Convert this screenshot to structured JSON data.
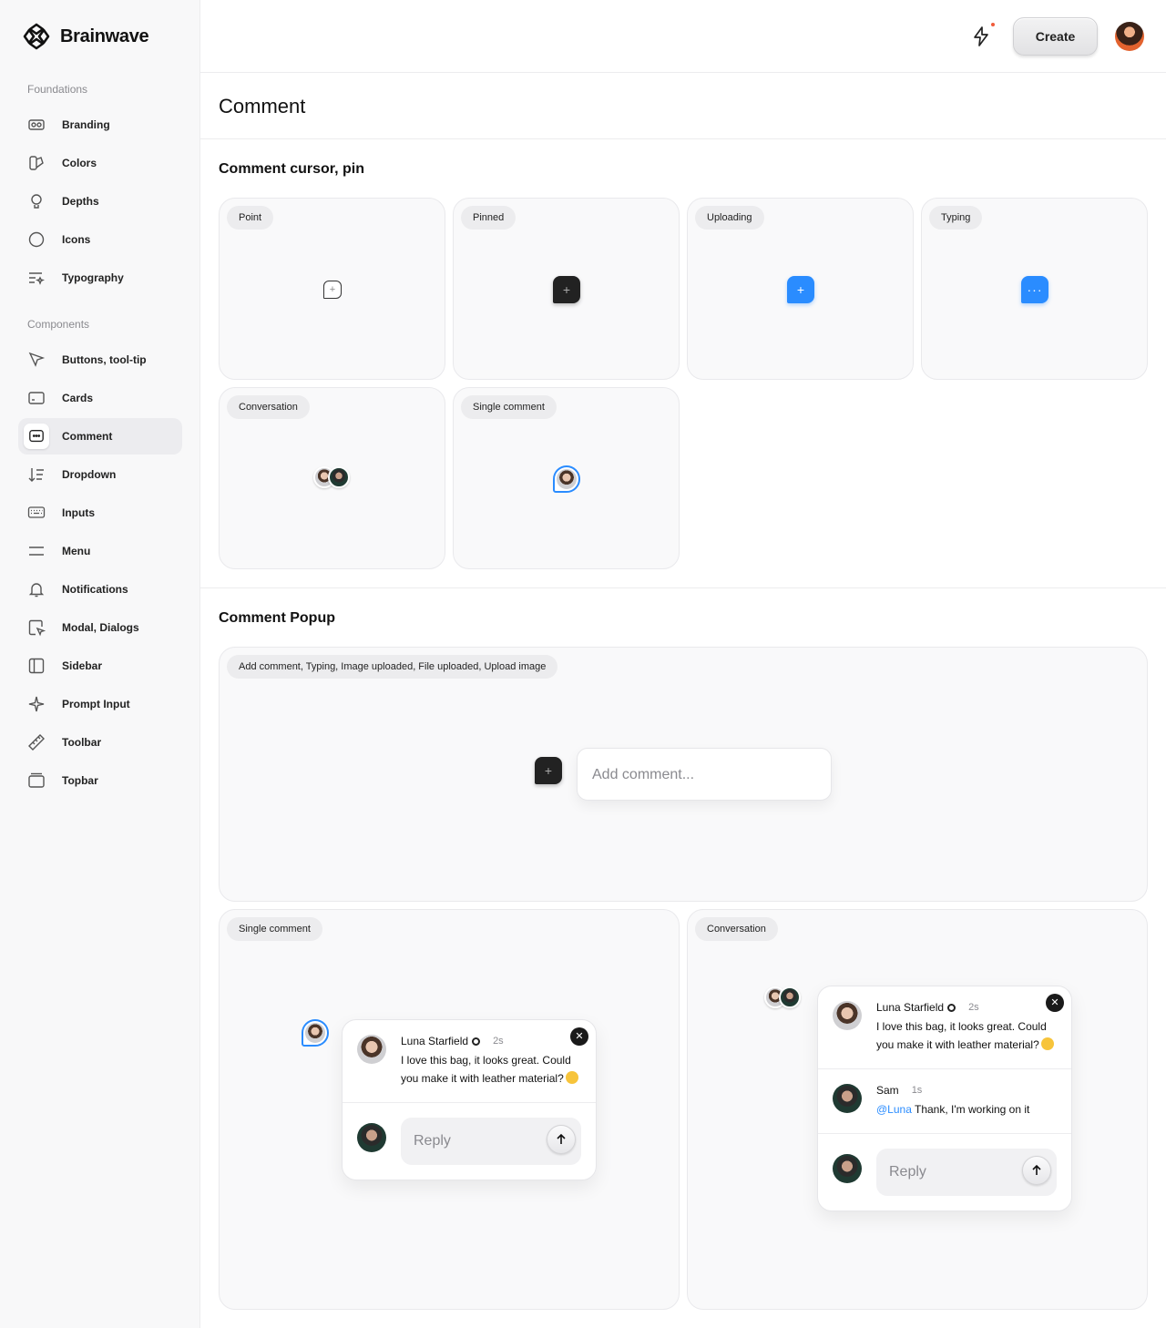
{
  "brand": {
    "name": "Brainwave"
  },
  "sidebar": {
    "foundations_label": "Foundations",
    "foundations": [
      {
        "label": "Branding",
        "icon": "branding-icon"
      },
      {
        "label": "Colors",
        "icon": "colors-icon"
      },
      {
        "label": "Depths",
        "icon": "depths-icon"
      },
      {
        "label": "Icons",
        "icon": "icons-icon"
      },
      {
        "label": "Typography",
        "icon": "typography-icon"
      }
    ],
    "components_label": "Components",
    "components": [
      {
        "label": "Buttons, tool-tip",
        "icon": "cursor-icon"
      },
      {
        "label": "Cards",
        "icon": "cards-icon"
      },
      {
        "label": "Comment",
        "icon": "comment-icon",
        "active": true
      },
      {
        "label": "Dropdown",
        "icon": "dropdown-icon"
      },
      {
        "label": "Inputs",
        "icon": "keyboard-icon"
      },
      {
        "label": "Menu",
        "icon": "menu-icon"
      },
      {
        "label": "Notifications",
        "icon": "bell-icon"
      },
      {
        "label": "Modal, Dialogs",
        "icon": "modal-icon"
      },
      {
        "label": "Sidebar",
        "icon": "sidebar-icon"
      },
      {
        "label": "Prompt Input",
        "icon": "sparkle-icon"
      },
      {
        "label": "Toolbar",
        "icon": "ruler-icon"
      },
      {
        "label": "Topbar",
        "icon": "topbar-icon"
      }
    ]
  },
  "topbar": {
    "create_label": "Create"
  },
  "page": {
    "title": "Comment"
  },
  "section1": {
    "title": "Comment cursor, pin",
    "cards": {
      "point": "Point",
      "pinned": "Pinned",
      "uploading": "Uploading",
      "typing": "Typing",
      "conversation": "Conversation",
      "single": "Single comment"
    },
    "typing_glyph": "···",
    "plus_glyph": "+"
  },
  "section2": {
    "title": "Comment Popup",
    "states_tag": "Add comment, Typing, Image uploaded, File uploaded, Upload image",
    "add_placeholder": "Add comment...",
    "single_tag": "Single comment",
    "conversation_tag": "Conversation",
    "comment": {
      "author": "Luna Starfield",
      "time": "2s",
      "text": "I love this bag, it looks great. Could you make it with leather material?"
    },
    "reply": {
      "author": "Sam",
      "time": "1s",
      "mention": "@Luna",
      "text": " Thank, I'm working on it"
    },
    "reply_placeholder": "Reply",
    "close_glyph": "✕"
  },
  "colors": {
    "accent": "#2a8cff",
    "dark": "#222222",
    "notification": "#f05b3a"
  }
}
